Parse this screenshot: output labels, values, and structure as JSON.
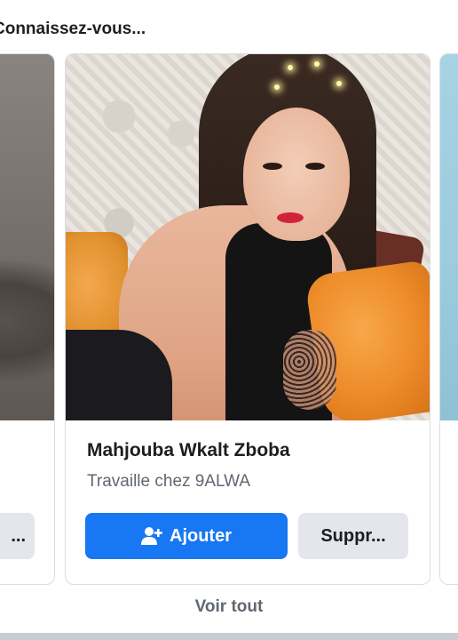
{
  "section": {
    "title": "Connaissez-vous..."
  },
  "cards": {
    "left": {
      "button_label": "..."
    },
    "main": {
      "name": "Mahjouba Wkalt Zboba",
      "subtitle": "Travaille chez 9ALWA",
      "add_label": "Ajouter",
      "add_icon": "add-friend-icon",
      "remove_label": "Suppr..."
    }
  },
  "footer": {
    "see_all_label": "Voir tout"
  },
  "colors": {
    "accent": "#1877f2",
    "secondary_button": "#e4e6eb",
    "muted_text": "#606770"
  }
}
